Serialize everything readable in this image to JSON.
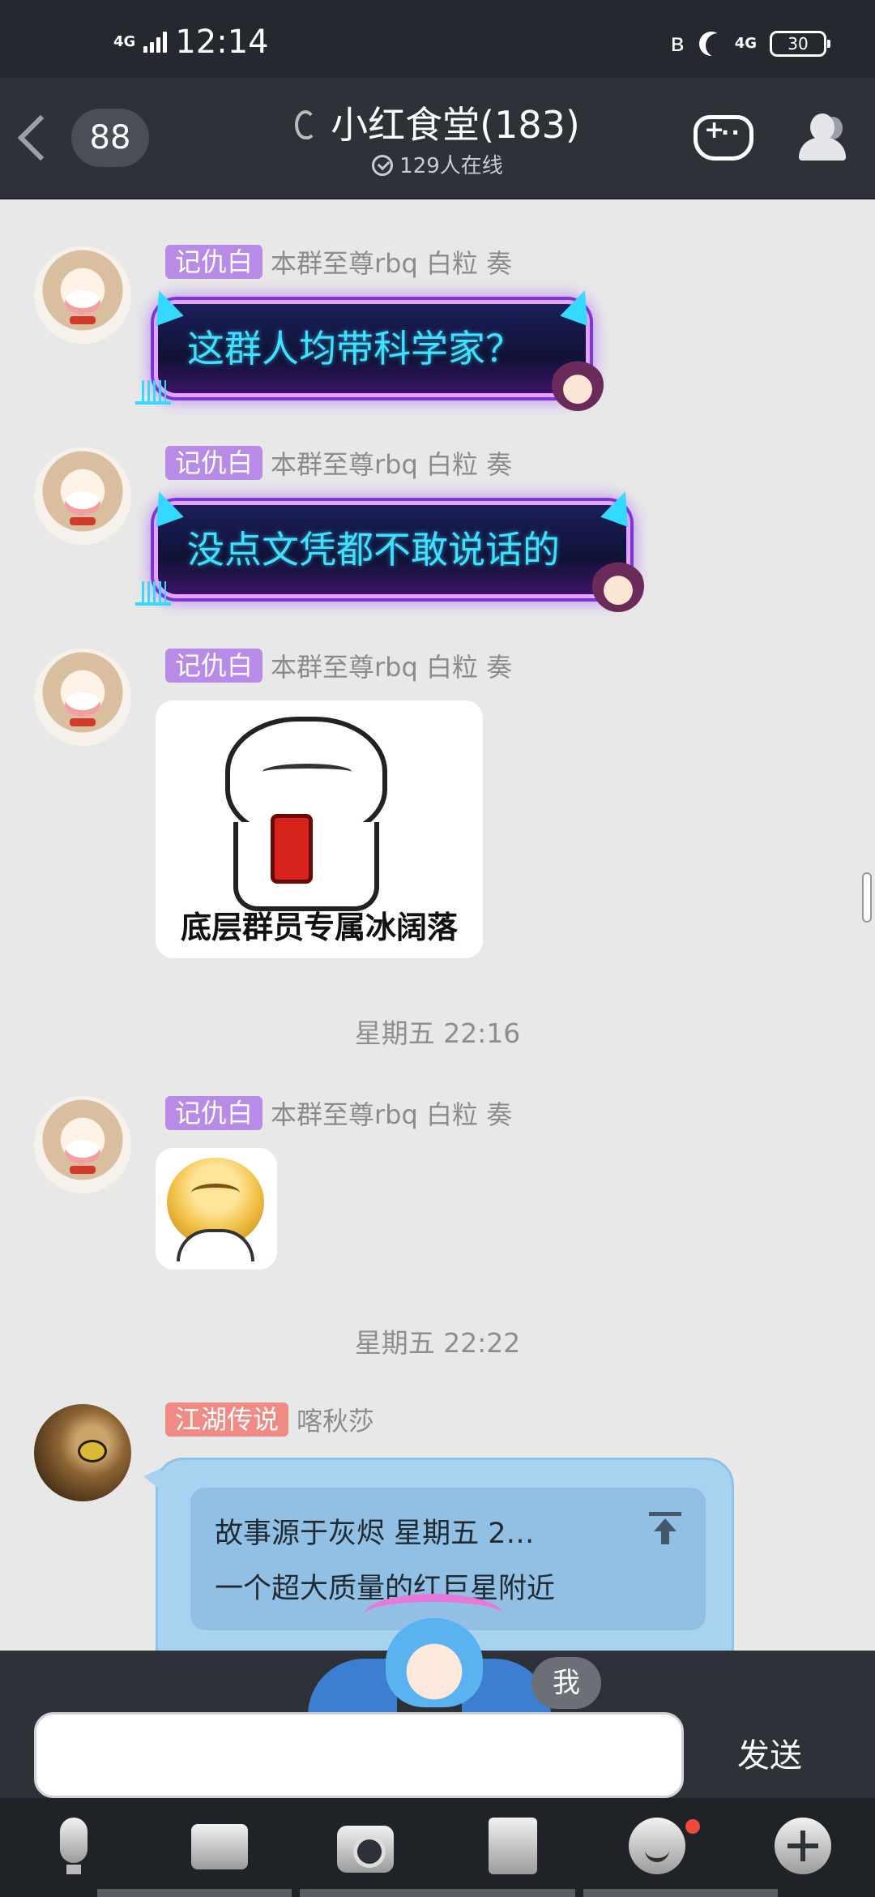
{
  "status_bar": {
    "network": "4G",
    "time": "12:14",
    "network_right": "4G",
    "battery": "30",
    "icons": [
      "signal-icon",
      "bluetooth-icon",
      "moon-icon",
      "battery-icon"
    ]
  },
  "header": {
    "unread_count": "88",
    "title": "小红食堂(183)",
    "online_text": "129人在线",
    "icons": [
      "back-icon",
      "ear-icon",
      "game-controller-icon",
      "members-icon"
    ]
  },
  "messages": [
    {
      "tag": "记仇白",
      "name": "本群至尊rbq 白粒 奏",
      "text": "这群人均带科学家？"
    },
    {
      "tag": "记仇白",
      "name": "本群至尊rbq 白粒 奏",
      "text": "没点文凭都不敢说话的"
    },
    {
      "tag": "记仇白",
      "name": "本群至尊rbq 白粒 奏",
      "caption": "底层群员专属冰阔落"
    },
    {
      "tag": "记仇白",
      "name": "本群至尊rbq 白粒 奏"
    },
    {
      "tag": "江湖传说",
      "name": "喀秋莎",
      "quote_line1": "故事源于灰烬 星期五 2…",
      "quote_line2": "一个超大质量的红巨星附近"
    }
  ],
  "timestamps": [
    "星期五 22:16",
    "星期五 22:22"
  ],
  "input": {
    "me_label": "我",
    "value": "",
    "send_label": "发送"
  },
  "toolbar": {
    "icons": [
      "microphone-icon",
      "photo-icon",
      "camera-icon",
      "file-icon",
      "emoji-icon",
      "plus-icon"
    ]
  },
  "colors": {
    "header_bg": "#2d3138",
    "chat_bg": "#e8e8e8",
    "tag_purple": "#b78be6",
    "tag_red": "#f08a84",
    "bubble_blue": "#a9d2f1",
    "neon_text": "#40e0ff",
    "notification_dot": "#f04a3a"
  }
}
